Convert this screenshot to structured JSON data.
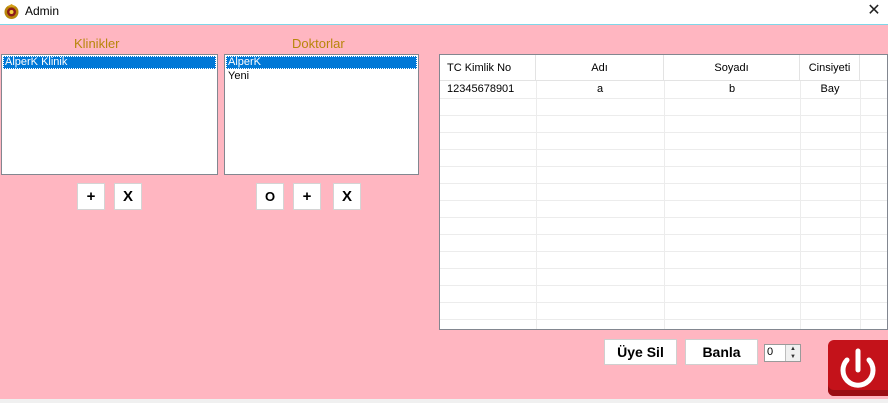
{
  "window": {
    "title": "Admin",
    "close_glyph": "✕",
    "app_icon": "app-emblem-icon"
  },
  "klinikler": {
    "label": "Klinikler",
    "items": [
      "AlperK Klinik"
    ],
    "selected": 0,
    "add_label": "+",
    "delete_label": "X"
  },
  "doktorlar": {
    "label": "Doktorlar",
    "items": [
      "AlperK",
      "Yeni"
    ],
    "selected": 0,
    "o_label": "O",
    "add_label": "+",
    "delete_label": "X"
  },
  "grid": {
    "columns": [
      "TC Kimlik No",
      "Adı",
      "Soyadı",
      "Cinsiyeti"
    ],
    "rows": [
      [
        "12345678901",
        "a",
        "b",
        "Bay"
      ]
    ]
  },
  "actions": {
    "delete_member_label": "Üye Sil",
    "ban_label": "Banla",
    "spinner_value": "0",
    "power_icon": "power-icon"
  },
  "colors": {
    "background": "#ffb6c1",
    "label_color": "#b8860b",
    "selection": "#0078d7",
    "power": "#c4121a"
  }
}
